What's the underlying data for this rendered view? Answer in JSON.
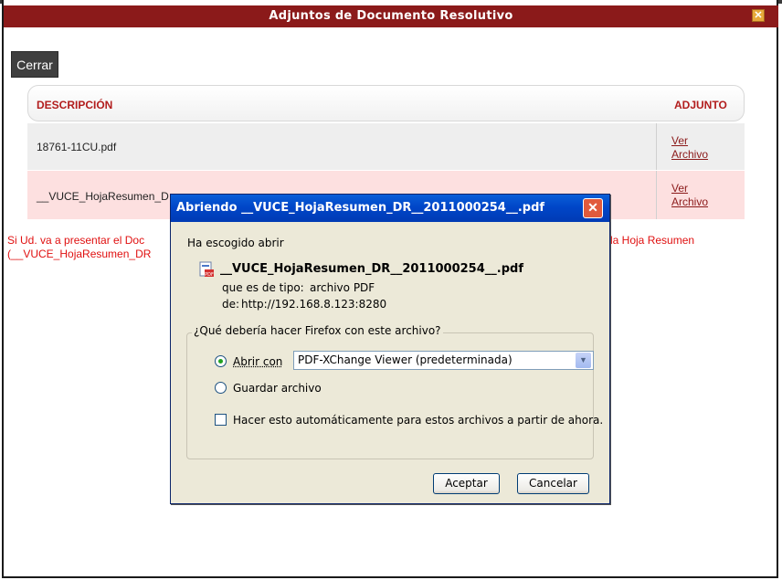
{
  "modal": {
    "title": "Adjuntos de Documento Resolutivo",
    "close_glyph": "✕"
  },
  "cerrar_label": "Cerrar",
  "table": {
    "col_description": "DESCRIPCIÓN",
    "col_attachment": "ADJUNTO",
    "rows": [
      {
        "description": "18761-11CU.pdf",
        "link_line1": "Ver",
        "link_line2": "Archivo"
      },
      {
        "description": "__VUCE_HojaResumen_D",
        "link_line1": "Ver",
        "link_line2": "Archivo"
      }
    ]
  },
  "notice": {
    "line1_left": "Si Ud. va a presentar el Doc",
    "line1_right": "la Hoja Resumen",
    "line2_left": "(__VUCE_HojaResumen_DR"
  },
  "dialog": {
    "title": "Abriendo __VUCE_HojaResumen_DR__2011000254__.pdf",
    "close_glyph": "✕",
    "chosen_label": "Ha escogido abrir",
    "filename": "__VUCE_HojaResumen_DR__2011000254__.pdf",
    "type_label": "que es de tipo:",
    "type_value": "archivo PDF",
    "from_label": "de:",
    "from_value": "http://192.168.8.123:8280",
    "question": "¿Qué debería hacer Firefox con este archivo?",
    "open_with_label": "Abrir con",
    "open_with_value": "PDF-XChange Viewer (predeterminada)",
    "save_label": "Guardar archivo",
    "auto_label": "Hacer esto automáticamente para estos archivos a partir de ahora.",
    "accept_label": "Aceptar",
    "cancel_label": "Cancelar",
    "selected_option": "Abrir con",
    "auto_checked": false
  },
  "colors": {
    "modal_title_bg": "#8b1a1a",
    "header_text": "#b21d1d",
    "notice_text": "#e01010",
    "dialog_title_bg": "#0046c8"
  },
  "icons": [
    "close-icon",
    "pdf-file-icon",
    "chevron-down-icon"
  ]
}
